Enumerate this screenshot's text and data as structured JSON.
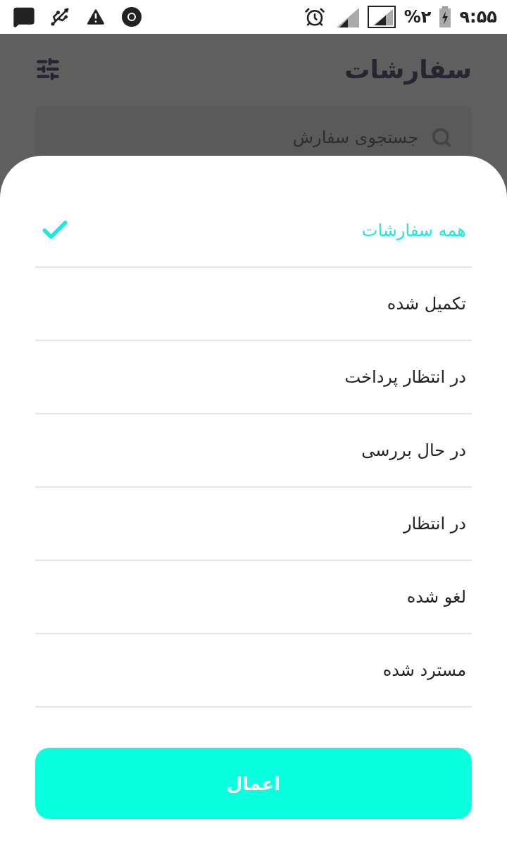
{
  "status_bar": {
    "battery": "%۲",
    "time": "۹:۵۵"
  },
  "header": {
    "title": "سفارشات"
  },
  "search": {
    "placeholder": "جستجوی سفارش"
  },
  "filter_sheet": {
    "options": [
      {
        "label": "همه سفارشات",
        "selected": true
      },
      {
        "label": "تکمیل شده",
        "selected": false
      },
      {
        "label": "در انتظار پرداخت",
        "selected": false
      },
      {
        "label": "در حال بررسی",
        "selected": false
      },
      {
        "label": "در انتظار",
        "selected": false
      },
      {
        "label": "لغو شده",
        "selected": false
      },
      {
        "label": "مسترد شده",
        "selected": false
      }
    ],
    "apply_button": "اعمال"
  }
}
